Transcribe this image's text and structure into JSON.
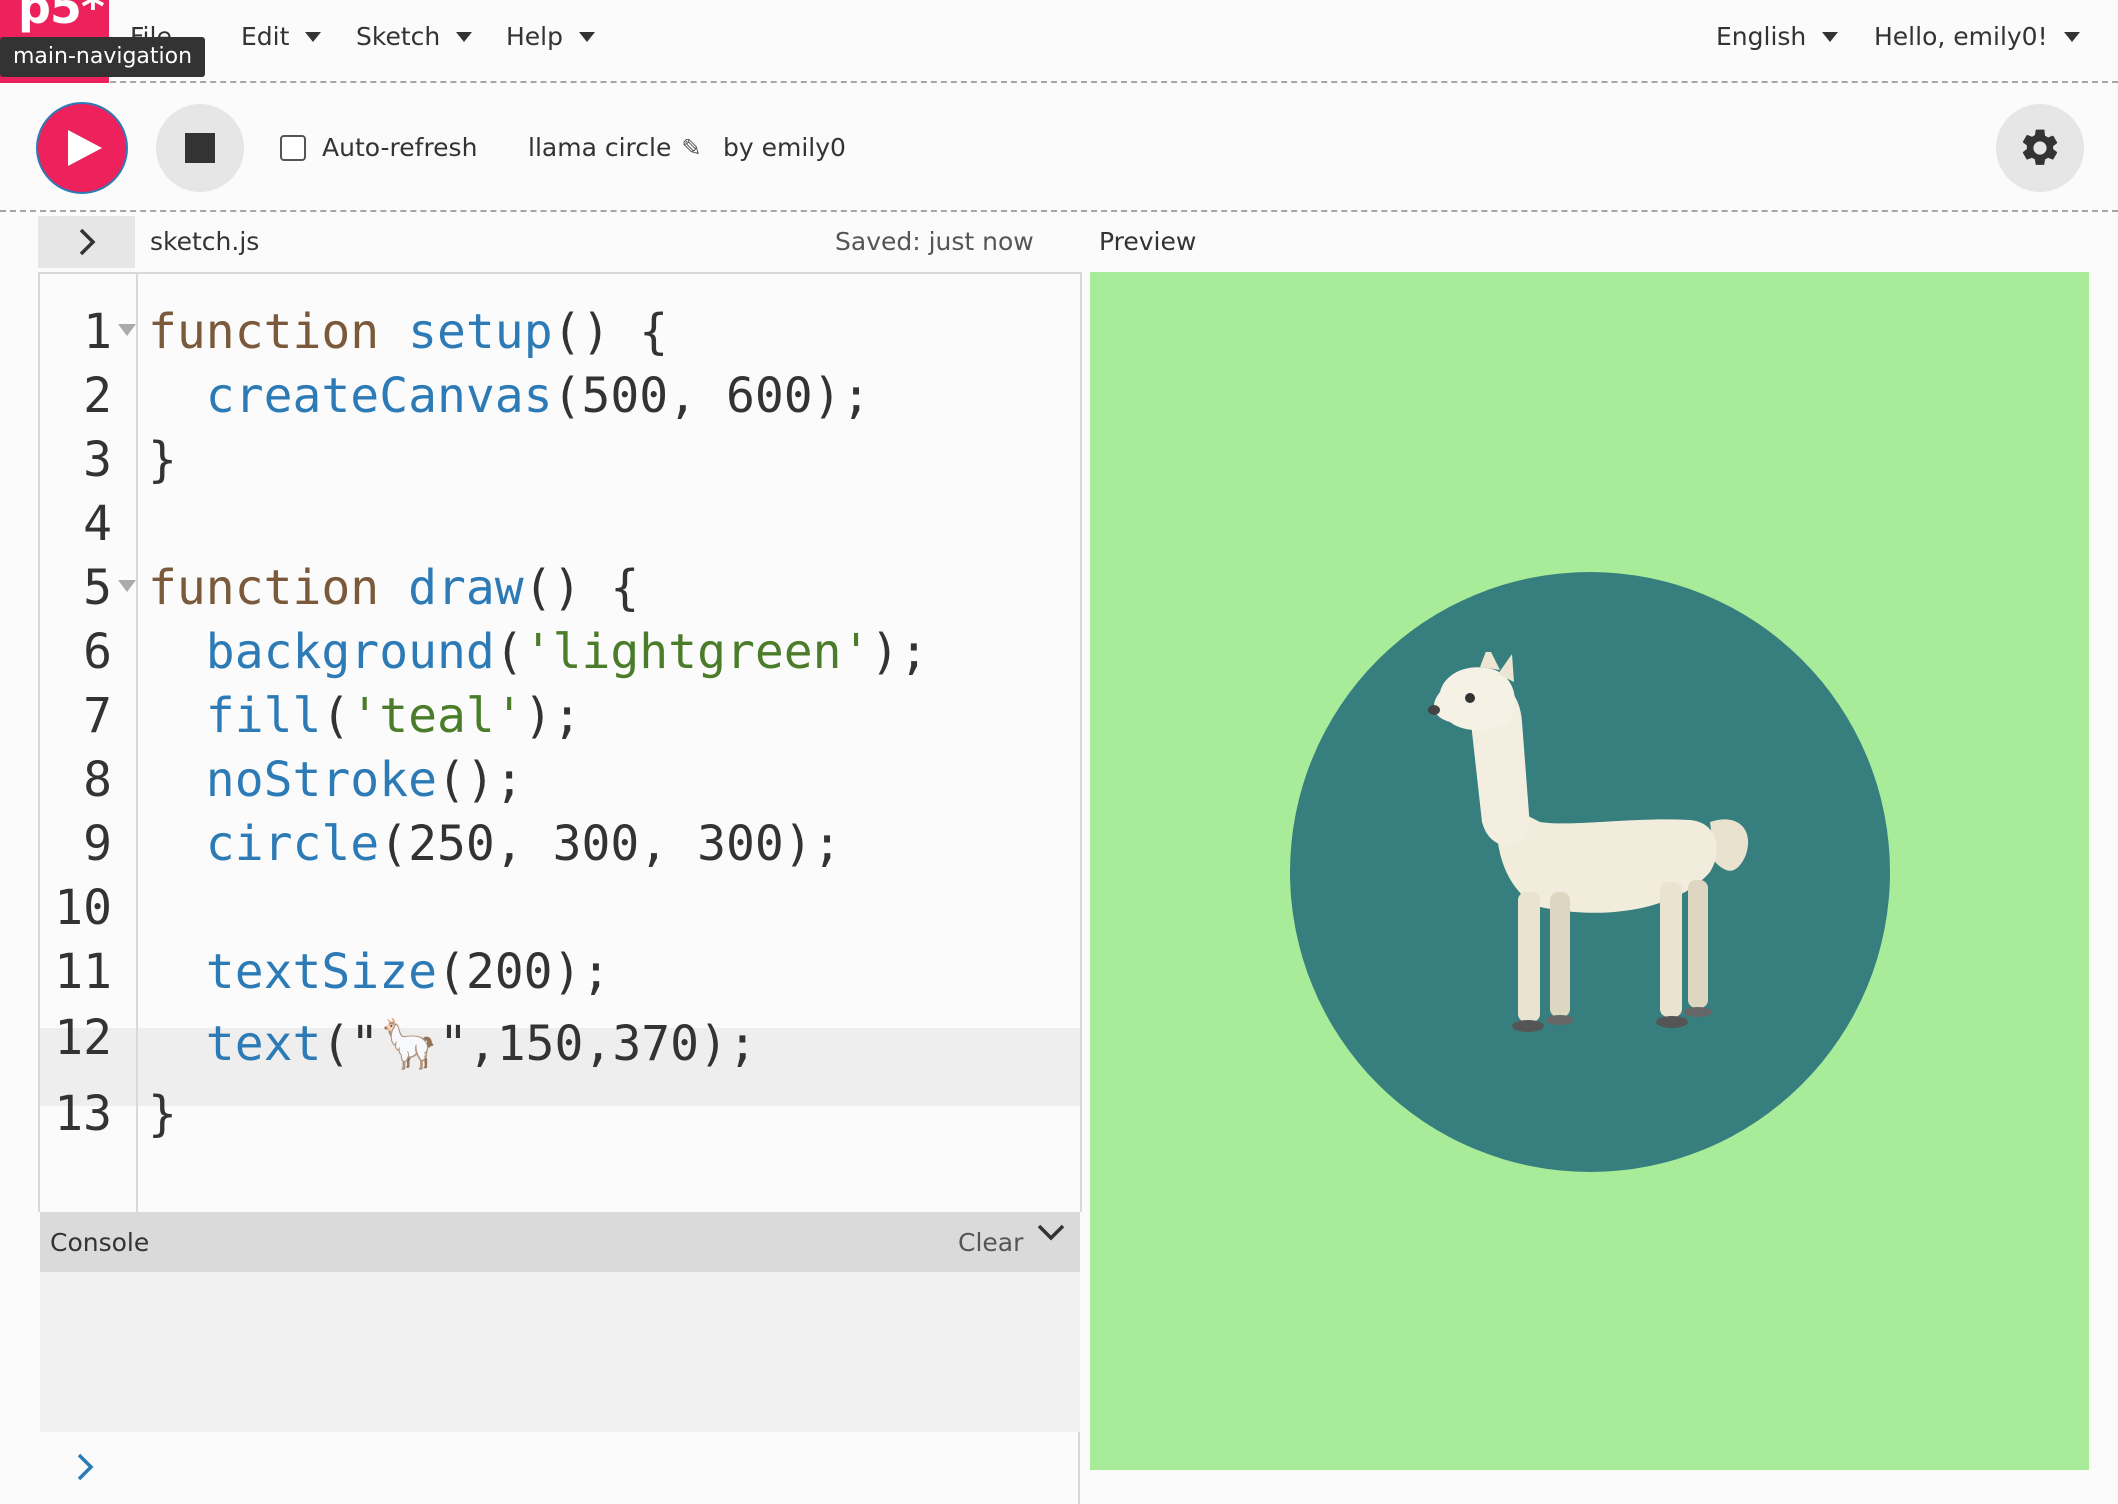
{
  "nav": {
    "logo_text": "p5*",
    "file_label": "File",
    "tooltip": "main-navigation",
    "menus": [
      {
        "label": "Edit"
      },
      {
        "label": "Sketch"
      },
      {
        "label": "Help"
      }
    ],
    "language": "English",
    "user_greeting": "Hello, emily0!"
  },
  "toolbar": {
    "autorefresh_label": "Auto-refresh",
    "autorefresh_checked": false,
    "sketch_name": "llama circle",
    "byline": "by emily0"
  },
  "editor": {
    "file_name": "sketch.js",
    "saved_status": "Saved: just now",
    "active_line": 12,
    "line_numbers": [
      "1",
      "2",
      "3",
      "4",
      "5",
      "6",
      "7",
      "8",
      "9",
      "10",
      "11",
      "12",
      "13"
    ]
  },
  "preview": {
    "label": "Preview",
    "background_color": "#a8ec99",
    "circle_color": "#367f7e",
    "emoji": "llama"
  },
  "console": {
    "title": "Console",
    "clear_label": "Clear"
  },
  "colors": {
    "accent": "#ed225d",
    "keyword": "#7a5a3a",
    "function": "#2d7bb6",
    "string": "#4a7c2a"
  }
}
